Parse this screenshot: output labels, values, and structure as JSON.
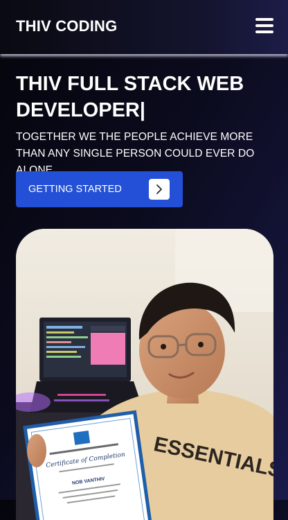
{
  "navbar": {
    "brand": "THIV CODING",
    "menu_icon": "hamburger-menu-icon"
  },
  "hero": {
    "title": "THIV FULL STACK WEB DEVELOPER|",
    "subtitle": "TOGETHER WE THE PEOPLE ACHIEVE MORE THAN ANY SINGLE PERSON COULD EVER DO ALONE",
    "cta_label": "GETTING STARTED",
    "cta_icon": "chevron-right-icon"
  },
  "photo": {
    "cert_title": "Certificate of Completion",
    "cert_name": "NOB VANTHIV",
    "shirt_text": "ESSENTIALS"
  },
  "colors": {
    "accent": "#2350d6",
    "background": "#0b0b1e"
  }
}
